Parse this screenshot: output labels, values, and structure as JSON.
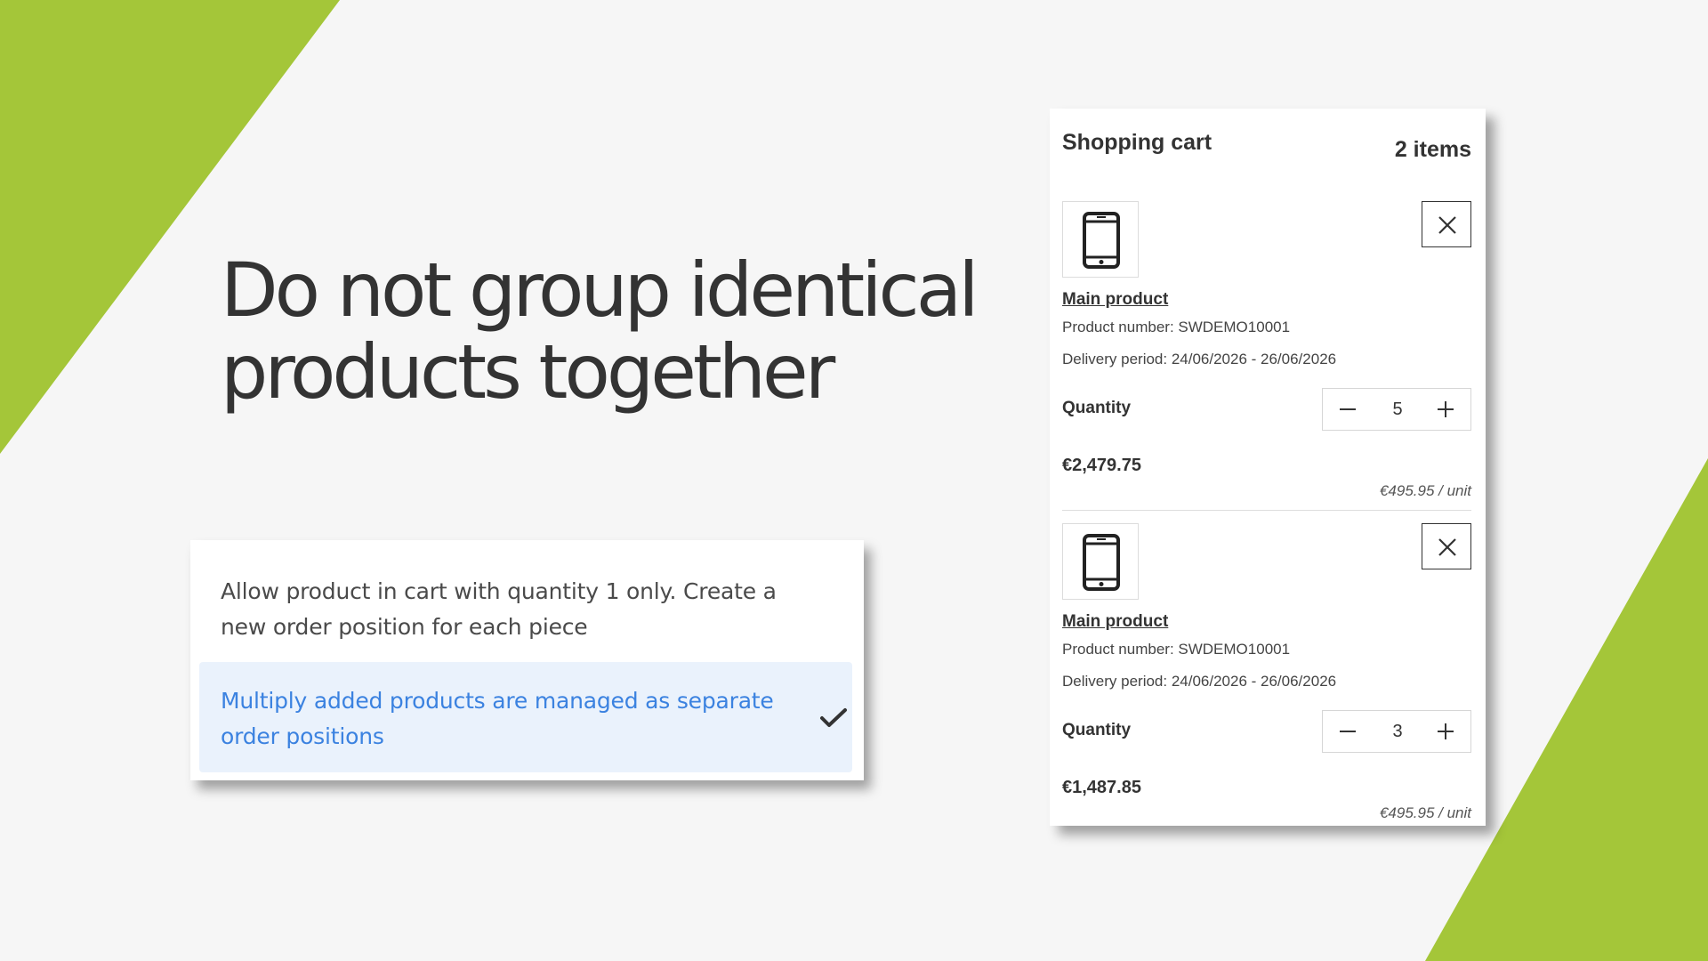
{
  "headline": {
    "line1": "Do not group identical",
    "line2": "products together"
  },
  "options": {
    "items": [
      {
        "label": "Allow product in cart with quantity 1 only. Create a new order position for each piece",
        "selected": false
      },
      {
        "label": "Multiply added products are managed as separate order positions",
        "selected": true
      }
    ]
  },
  "cart": {
    "title": "Shopping cart",
    "count_label": "2 items",
    "items": [
      {
        "icon": "smartphone-icon",
        "name": "Main product",
        "product_number": "Product number: SWDEMO10001",
        "delivery": "Delivery period: 24/06/2026 - 26/06/2026",
        "quantity_label": "Quantity",
        "quantity": "5",
        "total": "€2,479.75",
        "unit_price": "€495.95 / unit"
      },
      {
        "icon": "smartphone-icon",
        "name": "Main product",
        "product_number": "Product number: SWDEMO10001",
        "delivery": "Delivery period: 24/06/2026 - 26/06/2026",
        "quantity_label": "Quantity",
        "quantity": "3",
        "total": "€1,487.85",
        "unit_price": "€495.95 / unit"
      }
    ]
  },
  "colors": {
    "accent_green": "#a4c639",
    "selected_bg": "#eaf2fc",
    "selected_text": "#3b82e0",
    "text_dark": "#333333"
  }
}
